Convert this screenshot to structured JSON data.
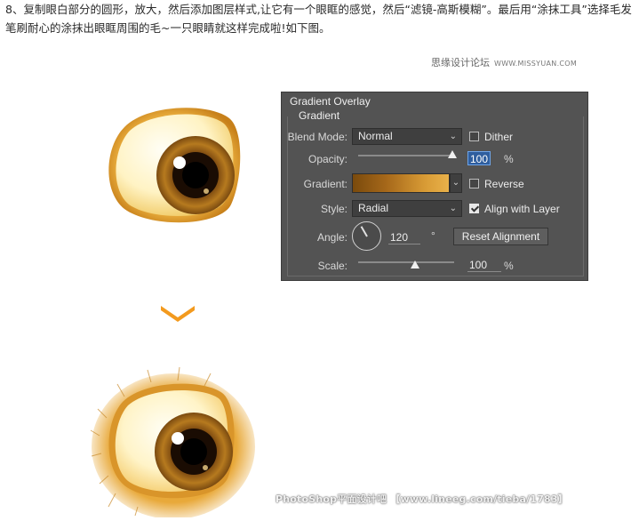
{
  "article": {
    "step_text": "8、复制眼白部分的圆形，放大，然后添加图层样式,让它有一个眼眶的感觉，然后“滤镜-高斯模糊”。最后用“涂抹工具”选择毛发笔刷耐心的涂抹出眼眶周围的毛~一只眼睛就这样完成啦!如下图。",
    "site_name": "思缘设计论坛",
    "site_url": "WWW.MISSYUAN.COM",
    "footer_watermark": "PhotoShop平面设计吧 【www.lineeg.com/tieba/1783】"
  },
  "panel": {
    "title": "Gradient Overlay",
    "group_title": "Gradient",
    "blend_mode": {
      "label": "Blend Mode:",
      "value": "Normal"
    },
    "dither": {
      "label": "Dither",
      "checked": false
    },
    "opacity": {
      "label": "Opacity:",
      "value": "100",
      "unit": "%",
      "fraction": 1.0
    },
    "gradient": {
      "label": "Gradient:",
      "colors": [
        "#7a4a0c",
        "#a6681a",
        "#d89b35",
        "#e9b14a"
      ]
    },
    "reverse": {
      "label": "Reverse",
      "checked": false
    },
    "style": {
      "label": "Style:",
      "value": "Radial"
    },
    "align_with_layer": {
      "label": "Align with Layer",
      "checked": true
    },
    "angle": {
      "label": "Angle:",
      "value": "120",
      "unit": "°"
    },
    "reset_button": "Reset Alignment",
    "scale": {
      "label": "Scale:",
      "value": "100",
      "unit": "%",
      "fraction": 0.5
    }
  },
  "icons": {
    "arrow": "chevron-down-icon",
    "colors": {
      "accent_orange": "#f39a1e",
      "panel_bg": "#535353"
    }
  }
}
